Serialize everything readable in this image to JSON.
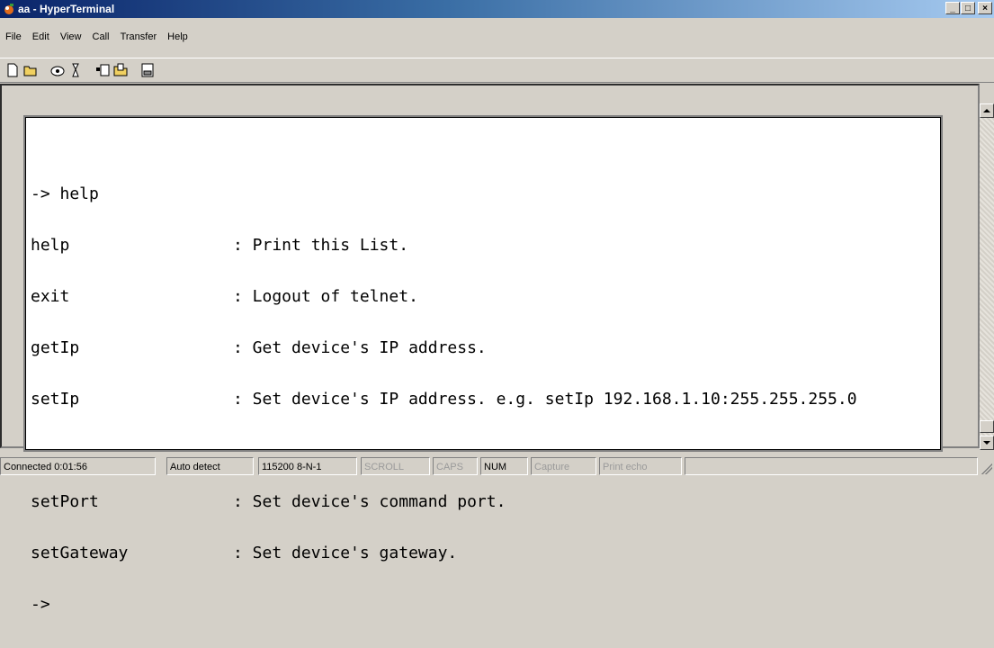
{
  "window": {
    "title": "aa - HyperTerminal",
    "controls": [
      "_",
      "□",
      "×"
    ]
  },
  "menu": [
    "File",
    "Edit",
    "View",
    "Call",
    "Transfer",
    "Help"
  ],
  "toolbar": {
    "icons": [
      "new-connection-icon",
      "open-icon",
      "call-icon",
      "disconnect-icon",
      "send-icon",
      "receive-icon",
      "properties-icon"
    ]
  },
  "terminal": {
    "lines": [
      {
        "cmd": "-> help",
        "desc": ""
      },
      {
        "cmd": "help",
        "desc": ": Print this List."
      },
      {
        "cmd": "exit",
        "desc": ": Logout of telnet."
      },
      {
        "cmd": "getIp",
        "desc": ": Get device's IP address."
      },
      {
        "cmd": "setIp",
        "desc": ": Set device's IP address. e.g. setIp 192.168.1.10:255.255.255.0"
      },
      {
        "cmd": "",
        "desc": ""
      },
      {
        "cmd": "setPort",
        "desc": ": Set device's command port."
      },
      {
        "cmd": "setGateway",
        "desc": ": Set device's gateway."
      },
      {
        "cmd": "->",
        "desc": ""
      }
    ]
  },
  "status": {
    "connected": "Connected 0:01:56",
    "detect": "Auto detect",
    "settings": "115200 8-N-1",
    "scroll": "SCROLL",
    "caps": "CAPS",
    "num": "NUM",
    "capture": "Capture",
    "print_echo": "Print echo"
  }
}
